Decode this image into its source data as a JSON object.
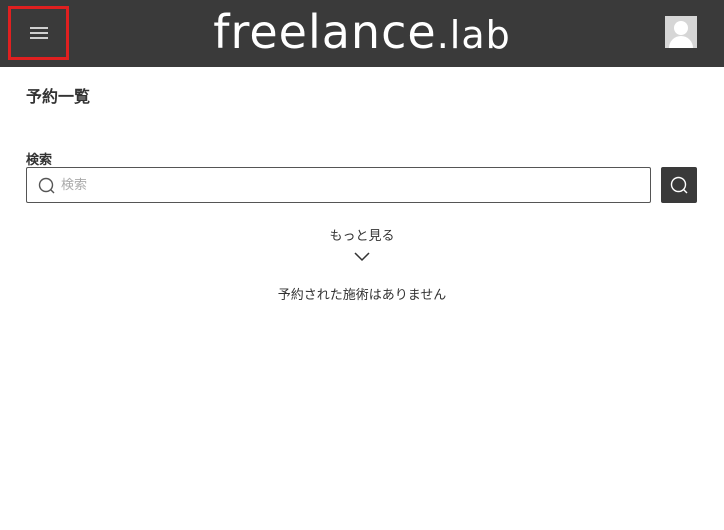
{
  "header": {
    "logo_main": "freelance",
    "logo_dot": ".lab",
    "menu_icon": "hamburger-menu-icon",
    "avatar_icon": "user-avatar-icon",
    "background_color": "#3a3a3a",
    "highlight_color": "#e02020"
  },
  "main": {
    "page_title": "予約一覧",
    "search_label": "検索",
    "search_placeholder": "検索",
    "search_value": "",
    "search_icon": "search-icon",
    "more_label": "もっと見る",
    "more_icon": "chevron-down-icon",
    "empty_message": "予約された施術はありません"
  }
}
